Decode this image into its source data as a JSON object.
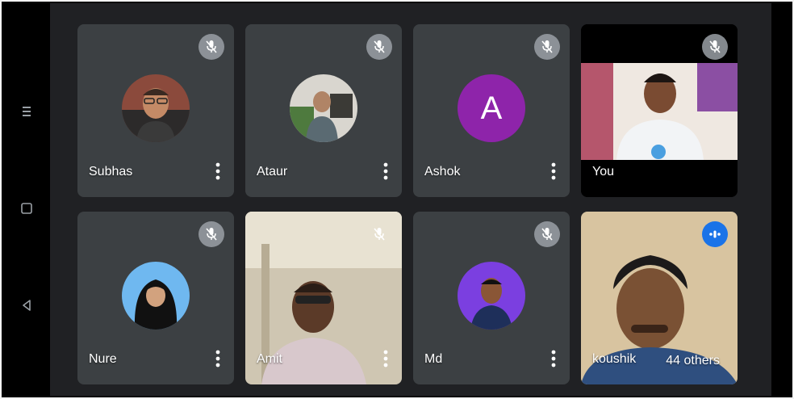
{
  "participants": [
    {
      "name": "Subhas",
      "muted": true
    },
    {
      "name": "Ataur",
      "muted": true
    },
    {
      "name": "Ashok",
      "muted": true,
      "avatar_letter": "A"
    },
    {
      "name": "You",
      "muted": true
    },
    {
      "name": "Nure",
      "muted": true
    },
    {
      "name": "Amit",
      "muted": true
    },
    {
      "name": "Md",
      "muted": true
    },
    {
      "name": "koushik",
      "muted": false
    }
  ],
  "others_label": "44 others",
  "colors": {
    "stage_bg": "#202124",
    "tile_bg": "#3c4043",
    "letter_avatar": "#8e24aa",
    "speaking_badge": "#1a73e8"
  },
  "icons": {
    "mute": "mic-off-icon",
    "speaking": "audio-indicator-icon",
    "more": "more-vert-icon",
    "nav_recents": "recents-icon",
    "nav_home": "home-icon",
    "nav_back": "back-icon"
  }
}
